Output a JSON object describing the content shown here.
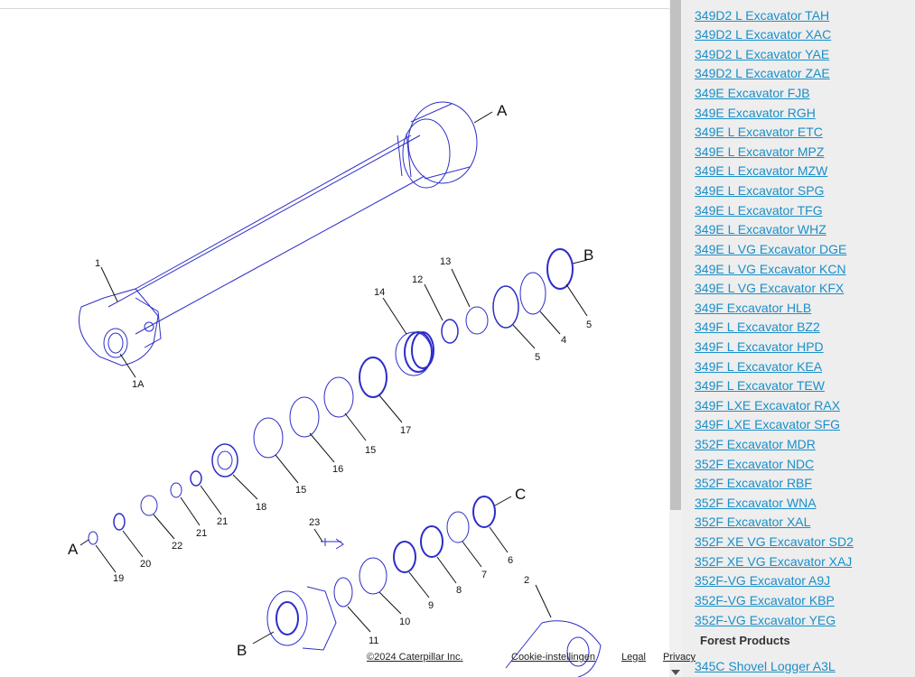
{
  "diagram": {
    "callouts": [
      "A",
      "1",
      "1A",
      "14",
      "12",
      "13",
      "B",
      "5",
      "4",
      "5",
      "17",
      "15",
      "16",
      "15",
      "18",
      "21",
      "21",
      "22",
      "20",
      "19",
      "A",
      "23",
      "C",
      "6",
      "7",
      "8",
      "9",
      "10",
      "11",
      "2",
      "B"
    ]
  },
  "sidebar": {
    "models": [
      "349D2 L Excavator TAH",
      "349D2 L Excavator XAC",
      "349D2 L Excavator YAE",
      "349D2 L Excavator ZAE",
      "349E Excavator FJB",
      "349E Excavator RGH",
      "349E L Excavator ETC",
      "349E L Excavator MPZ",
      "349E L Excavator MZW",
      "349E L Excavator SPG",
      "349E L Excavator TFG",
      "349E L Excavator WHZ",
      "349E L VG Excavator DGE",
      "349E L VG Excavator KCN",
      "349E L VG Excavator KFX",
      "349F Excavator HLB",
      "349F L Excavator BZ2",
      "349F L Excavator HPD",
      "349F L Excavator KEA",
      "349F L Excavator TEW",
      "349F LXE Excavator RAX",
      "349F LXE Excavator SFG",
      "352F Excavator MDR",
      "352F Excavator NDC",
      "352F Excavator RBF",
      "352F Excavator WNA",
      "352F Excavator XAL",
      "352F XE VG Excavator SD2",
      "352F XE VG Excavator XAJ",
      "352F-VG Excavator A9J",
      "352F-VG Excavator KBP",
      "352F-VG Excavator YEG"
    ],
    "section_heading": "Forest Products",
    "next_item": "345C Shovel Logger A3L"
  },
  "footer": {
    "copyright": "©2024 Caterpillar Inc.",
    "cookie": "Cookie-instellingen",
    "legal": "Legal",
    "privacy": "Privacy"
  },
  "colors": {
    "line": "#2d2dc8",
    "link": "#1a8fc9",
    "sidebar_bg": "#eeeeee"
  }
}
